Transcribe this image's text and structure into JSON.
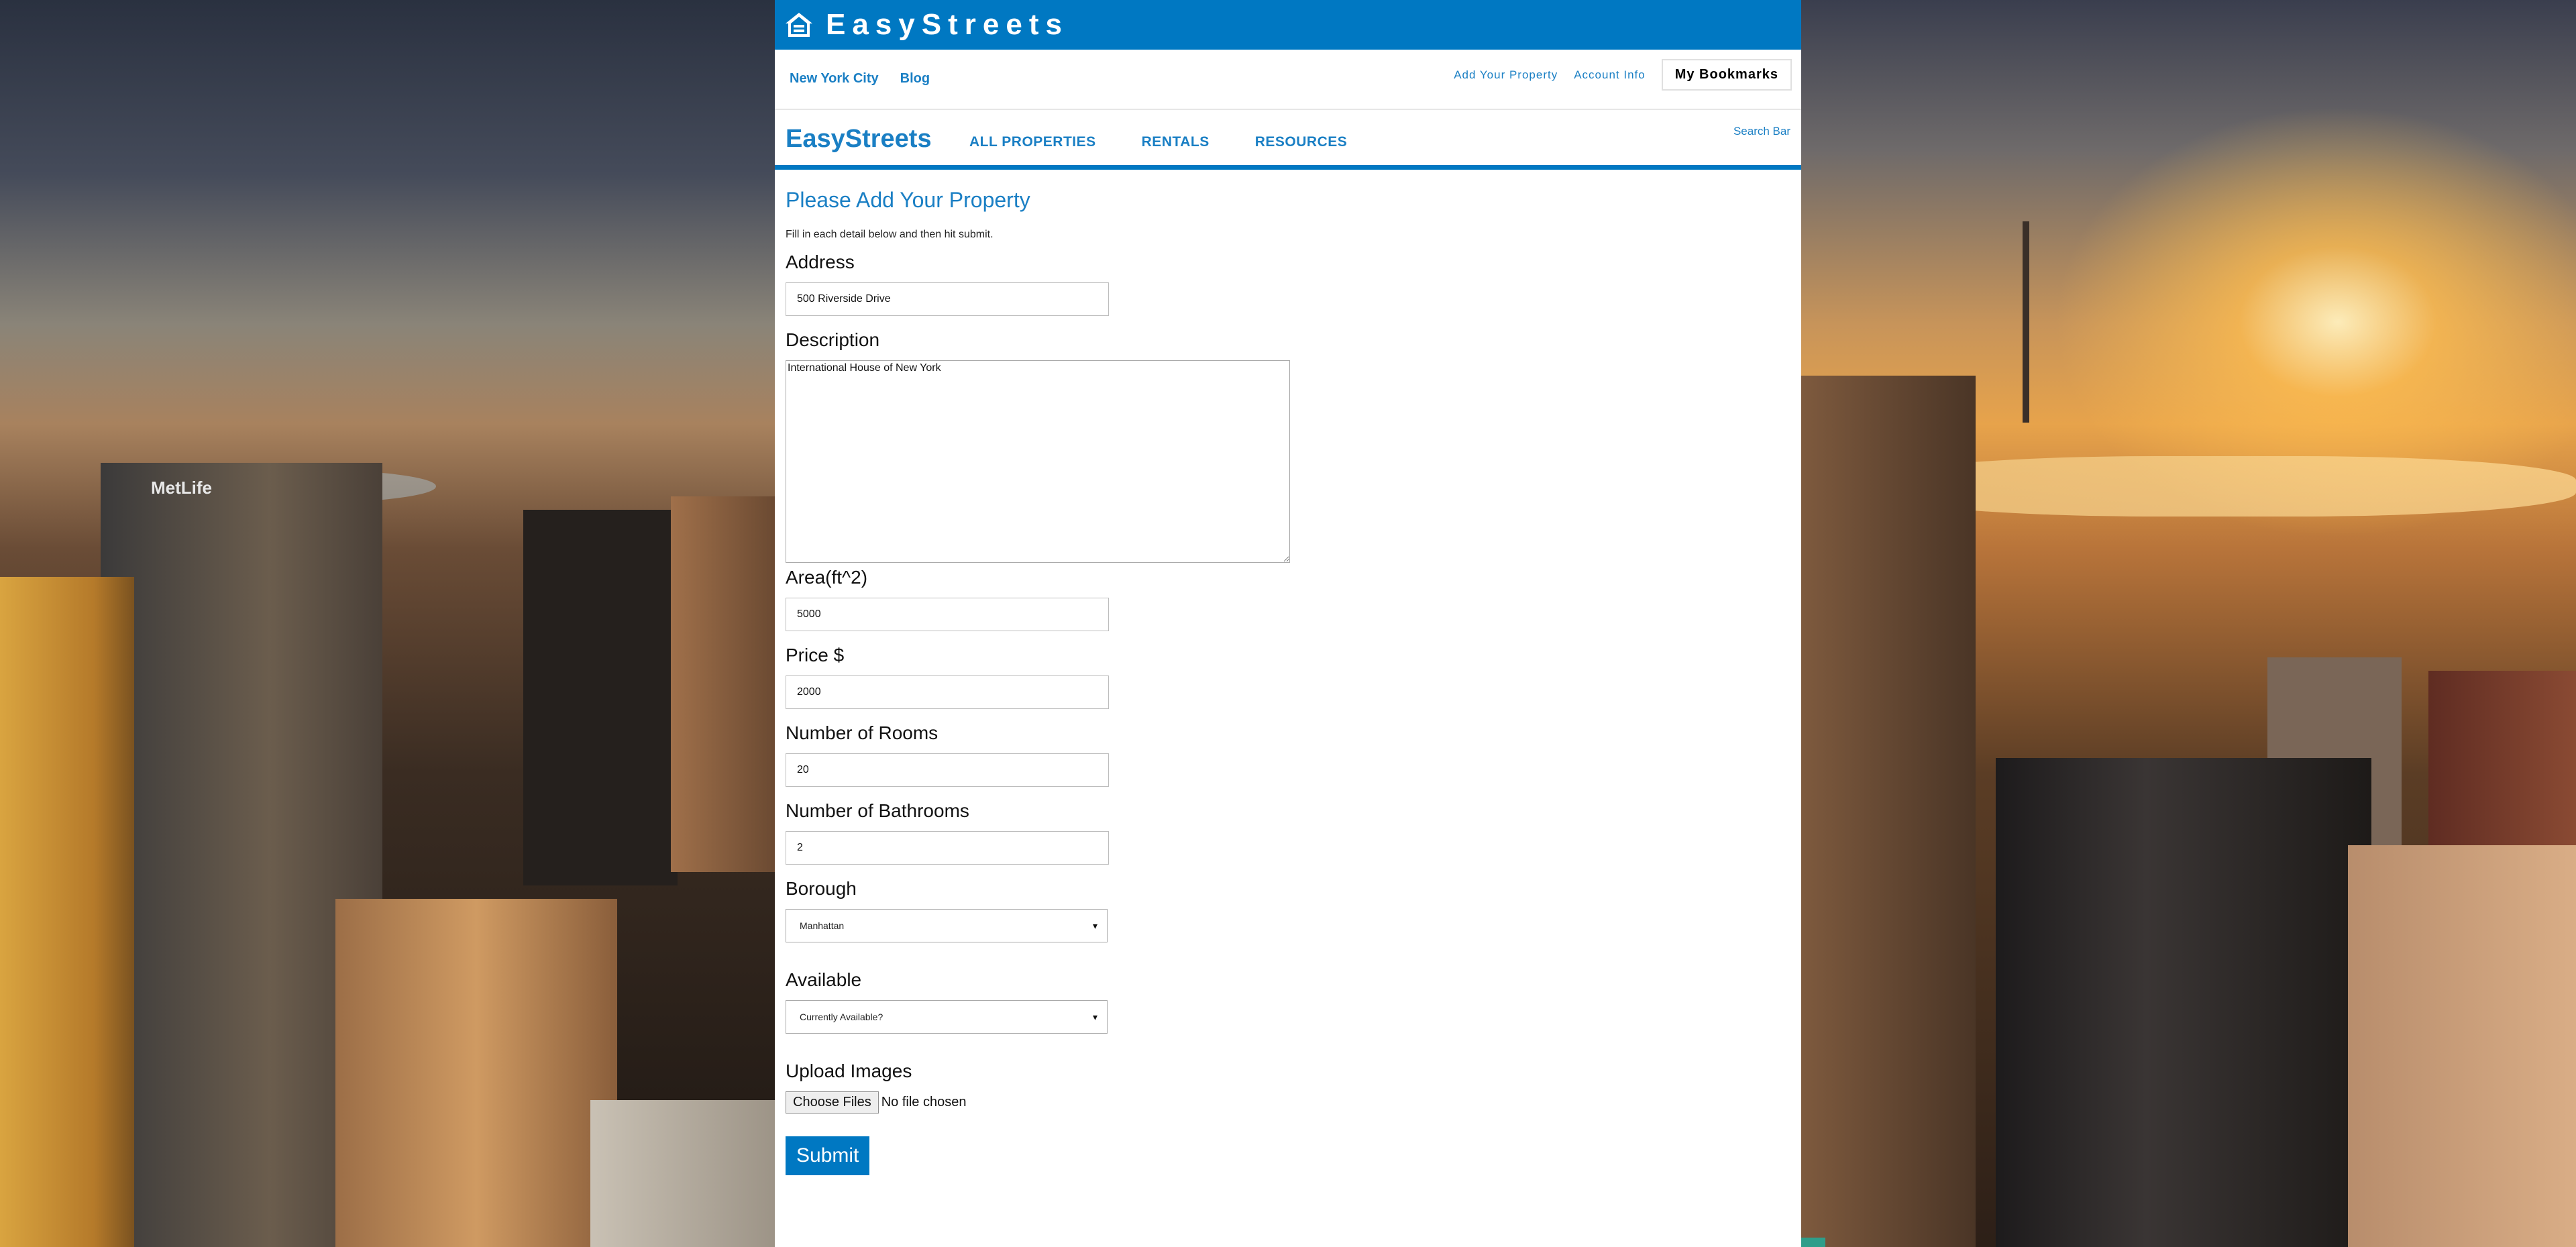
{
  "app": {
    "brand": "EasyStreets",
    "brand_icon": "fair-housing-house-icon",
    "accent_color": "#0078c2"
  },
  "subnav": {
    "left": [
      "New York City",
      "Blog"
    ],
    "right": [
      "Add Your Property",
      "Account Info"
    ],
    "bookmarks": "My Bookmarks"
  },
  "mainnav": {
    "logo": "EasyStreets",
    "items": [
      "ALL PROPERTIES",
      "RENTALS",
      "RESOURCES"
    ],
    "search": "Search Bar"
  },
  "form": {
    "title": "Please Add Your Property",
    "intro": "Fill in each detail below and then hit submit.",
    "address": {
      "label": "Address",
      "value": "500 Riverside Drive"
    },
    "description": {
      "label": "Description",
      "value": "International House of New York"
    },
    "area": {
      "label": "Area(ft^2)",
      "value": "5000"
    },
    "price": {
      "label": "Price $",
      "value": "2000"
    },
    "rooms": {
      "label": "Number of Rooms",
      "value": "20"
    },
    "bathrooms": {
      "label": "Number of Bathrooms",
      "value": "2"
    },
    "borough": {
      "label": "Borough",
      "selected": "Manhattan"
    },
    "available": {
      "label": "Available",
      "selected": "Currently Available?"
    },
    "upload": {
      "label": "Upload Images",
      "button": "Choose Files",
      "status": "No file chosen"
    },
    "submit": "Submit"
  },
  "background": {
    "sign_text": "MetLife"
  }
}
